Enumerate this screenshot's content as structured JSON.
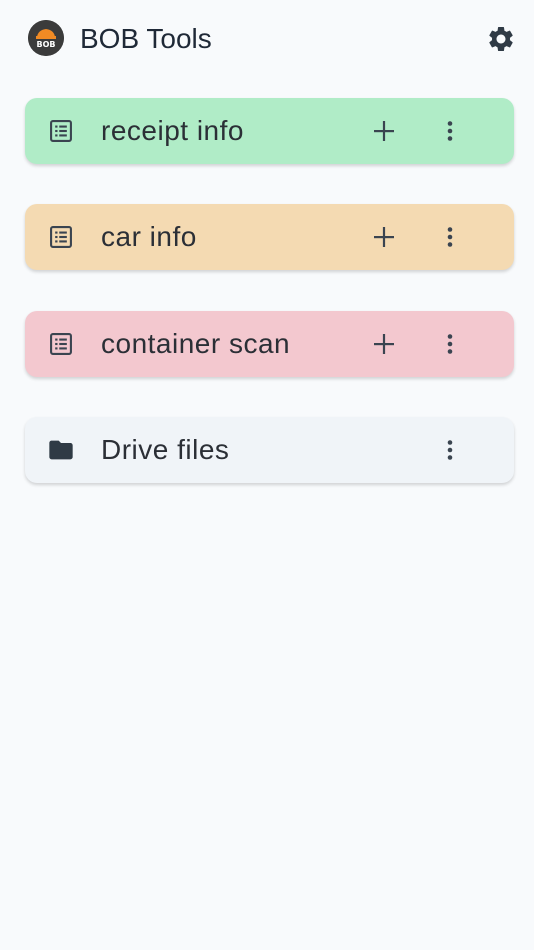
{
  "header": {
    "logo_text": "BOB",
    "title": "BOB Tools",
    "settings_icon": "gear-icon"
  },
  "cards": [
    {
      "label": "receipt info",
      "color": "#b0ecc7",
      "icon": "list-icon",
      "has_add": true
    },
    {
      "label": "car info",
      "color": "#f4dab2",
      "icon": "list-icon",
      "has_add": true
    },
    {
      "label": "container scan",
      "color": "#f3c8cf",
      "icon": "list-icon",
      "has_add": true
    },
    {
      "label": "Drive files",
      "color": "#f0f4f8",
      "icon": "folder-icon",
      "has_add": false
    }
  ]
}
